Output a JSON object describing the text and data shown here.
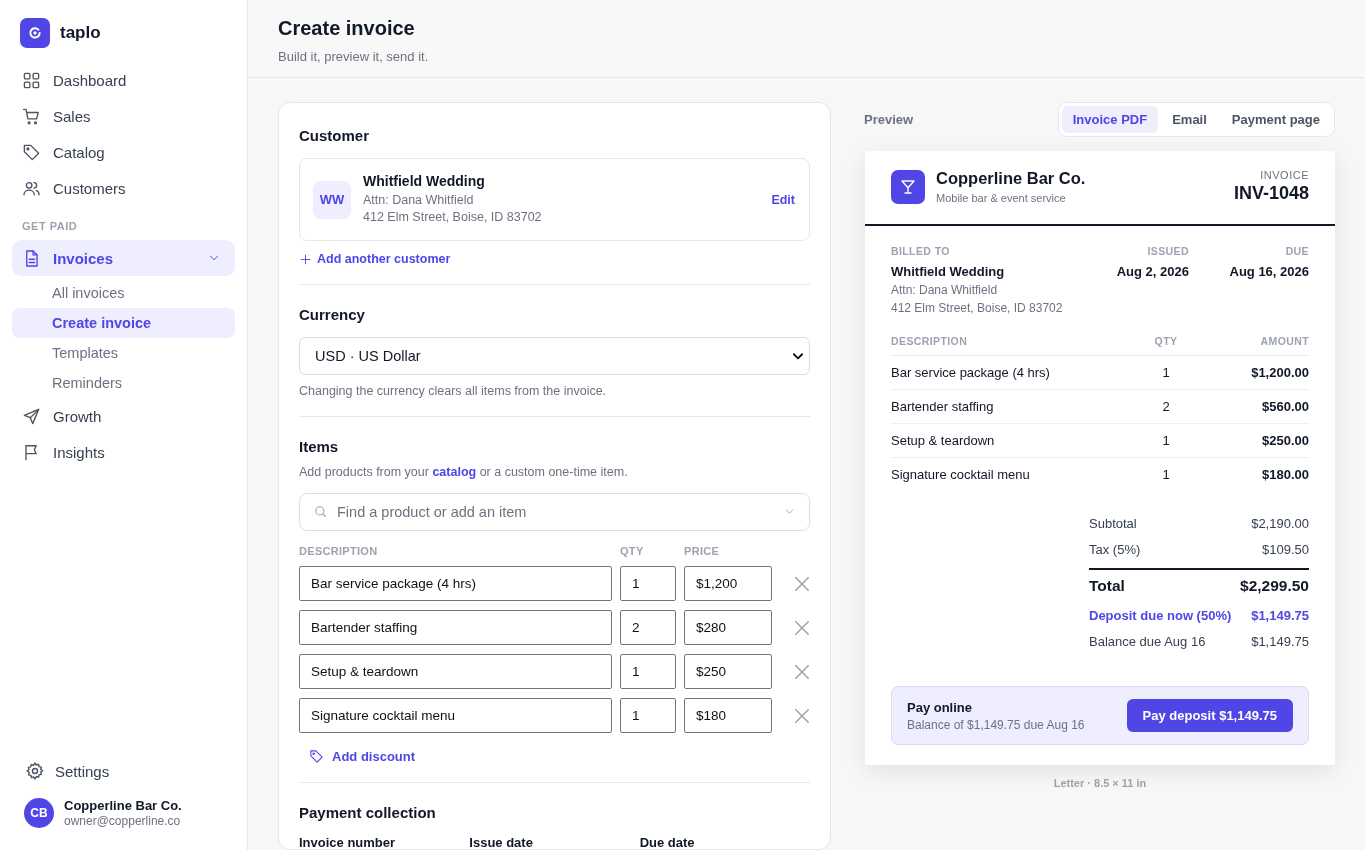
{
  "brand": {
    "name": "taplo"
  },
  "sidebar": {
    "items": [
      {
        "kind": "link",
        "label": "Dashboard",
        "selected": false
      },
      {
        "kind": "link",
        "label": "Sales",
        "selected": false
      },
      {
        "kind": "link",
        "label": "Catalog",
        "selected": false
      },
      {
        "kind": "link",
        "label": "Customers",
        "selected": false
      },
      {
        "kind": "section",
        "label": "GET PAID"
      },
      {
        "kind": "group",
        "label": "Invoices",
        "selected": true,
        "expanded": true,
        "children": [
          {
            "label": "All invoices",
            "selected": false
          },
          {
            "label": "Create invoice",
            "selected": true
          },
          {
            "label": "Templates",
            "selected": false
          },
          {
            "label": "Reminders",
            "selected": false
          }
        ]
      },
      {
        "kind": "link",
        "label": "Growth",
        "selected": false
      },
      {
        "kind": "link",
        "label": "Insights",
        "selected": false
      }
    ],
    "settings": "Settings",
    "account": {
      "initials": "CB",
      "name": "Copperline Bar Co.",
      "email": "owner@copperline.co"
    }
  },
  "header": {
    "title": "Create invoice",
    "subtitle": "Build it, preview it, send it."
  },
  "form": {
    "customer": {
      "heading": "Customer",
      "initials": "WW",
      "name": "Whitfield Wedding",
      "attn": "Attn: Dana Whitfield",
      "address": "412 Elm Street, Boise, ID 83702",
      "edit": "Edit",
      "add": "Add another customer"
    },
    "currency": {
      "heading": "Currency",
      "value": "USD · US Dollar",
      "note": "Changing the currency clears all items from the invoice."
    },
    "items": {
      "heading": "Items",
      "intro_before": "Add products from your",
      "intro_link": "catalog",
      "intro_after": "or a custom one-time item.",
      "search_placeholder": "Find a product or add an item",
      "columns": [
        "DESCRIPTION",
        "QTY",
        "PRICE"
      ],
      "rows": [
        {
          "description": "Bar service package (4 hrs)",
          "qty": "1",
          "price": "$1,200"
        },
        {
          "description": "Bartender staffing",
          "qty": "2",
          "price": "$280"
        },
        {
          "description": "Setup & teardown",
          "qty": "1",
          "price": "$250"
        },
        {
          "description": "Signature cocktail menu",
          "qty": "1",
          "price": "$180"
        }
      ],
      "add_discount": "Add discount"
    },
    "payment": {
      "heading": "Payment collection",
      "labels": [
        "Invoice number",
        "Issue date",
        "Due date"
      ]
    }
  },
  "preview": {
    "label": "Preview",
    "tabs": [
      {
        "label": "Invoice PDF",
        "selected": true
      },
      {
        "label": "Email",
        "selected": false
      },
      {
        "label": "Payment page",
        "selected": false
      }
    ],
    "invoice": {
      "company": "Copperline Bar Co.",
      "tagline": "Mobile bar & event service",
      "doc_label": "INVOICE",
      "number": "INV-1048",
      "billed_label": "BILLED TO",
      "billed_name": "Whitfield Wedding",
      "attn": "Attn: Dana Whitfield",
      "address": "412 Elm Street, Boise, ID 83702",
      "issued_label": "ISSUED",
      "issued": "Aug 2, 2026",
      "due_label": "DUE",
      "due": "Aug 16, 2026",
      "columns": [
        "DESCRIPTION",
        "QTY",
        "AMOUNT"
      ],
      "lines": [
        {
          "description": "Bar service package (4 hrs)",
          "qty": "1",
          "amount": "$1,200.00"
        },
        {
          "description": "Bartender staffing",
          "qty": "2",
          "amount": "$560.00"
        },
        {
          "description": "Setup & teardown",
          "qty": "1",
          "amount": "$250.00"
        },
        {
          "description": "Signature cocktail menu",
          "qty": "1",
          "amount": "$180.00"
        }
      ],
      "totals": [
        {
          "kind": "plain",
          "label": "Subtotal",
          "value": "$2,190.00"
        },
        {
          "kind": "plain",
          "label": "Tax (5%)",
          "value": "$109.50"
        },
        {
          "kind": "total",
          "label": "Total",
          "value": "$2,299.50"
        },
        {
          "kind": "deposit",
          "label": "Deposit due now (50%)",
          "value": "$1,149.75"
        },
        {
          "kind": "plain",
          "label": "Balance due Aug 16",
          "value": "$1,149.75"
        }
      ],
      "pay": {
        "title": "Pay online",
        "note": "Balance of $1,149.75 due Aug 16",
        "button": "Pay deposit $1,149.75"
      }
    },
    "footnote": "Letter · 8.5 × 11 in"
  }
}
